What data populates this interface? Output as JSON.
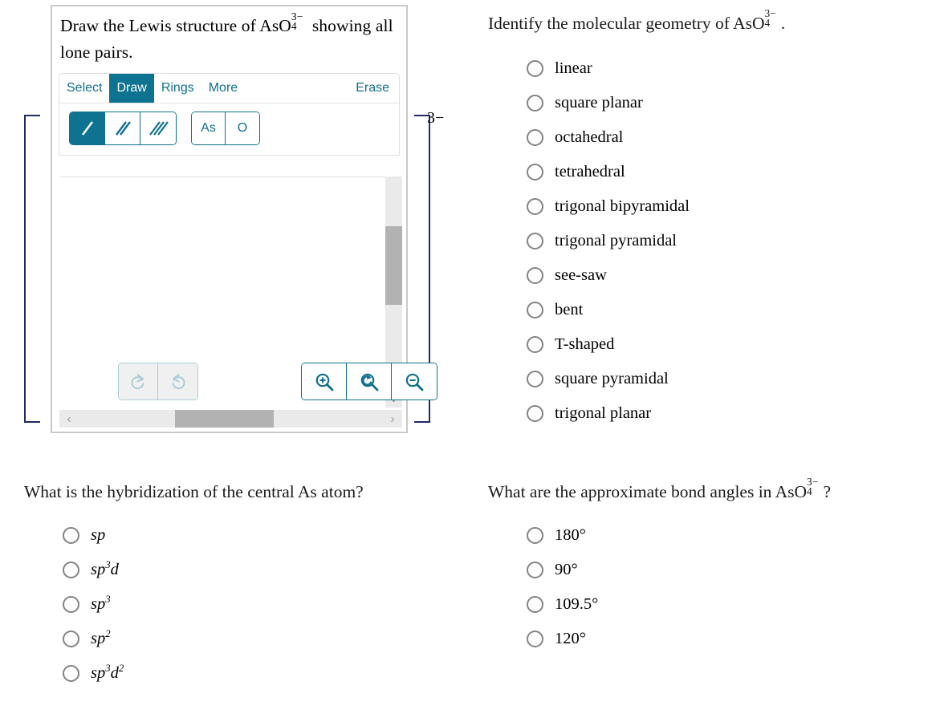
{
  "draw_question": {
    "prompt_prefix": "Draw the Lewis structure of ",
    "formula": {
      "base": "AsO",
      "charge": "3−",
      "index": "4"
    },
    "prompt_suffix": " showing all lone pairs.",
    "charge_bracket_label": "3−"
  },
  "editor": {
    "tabs": [
      {
        "label": "Select",
        "active": false
      },
      {
        "label": "Draw",
        "active": true
      },
      {
        "label": "Rings",
        "active": false
      },
      {
        "label": "More",
        "active": false
      }
    ],
    "erase_label": "Erase",
    "bond_tools": [
      {
        "name": "single-bond",
        "selected": true
      },
      {
        "name": "double-bond",
        "selected": false
      },
      {
        "name": "triple-bond",
        "selected": false
      }
    ],
    "element_buttons": [
      {
        "label": "As"
      },
      {
        "label": "O"
      }
    ],
    "history_buttons": [
      {
        "name": "redo-icon",
        "enabled": false
      },
      {
        "name": "undo-icon",
        "enabled": false
      }
    ],
    "zoom_buttons": [
      {
        "name": "zoom-in-icon"
      },
      {
        "name": "zoom-reset-icon"
      },
      {
        "name": "zoom-out-icon"
      }
    ],
    "scroll": {
      "horizontal_left_chevron": "‹",
      "horizontal_right_chevron": "›",
      "vertical_down_chevron": "∨"
    },
    "colors": {
      "accent": "#0d7390",
      "accent_text": "#10708d",
      "disabled_icon": "#a9cdd8",
      "panel_border": "#c8c8c8",
      "scroll_thumb": "#b2b2b2",
      "bracket": "#1f2a66"
    }
  },
  "geometry_question": {
    "prompt_prefix": "Identify the molecular geometry of ",
    "formula": {
      "base": "AsO",
      "charge": "3−",
      "index": "4"
    },
    "prompt_suffix": ".",
    "options": [
      "linear",
      "square planar",
      "octahedral",
      "tetrahedral",
      "trigonal bipyramidal",
      "trigonal pyramidal",
      "see-saw",
      "bent",
      "T-shaped",
      "square pyramidal",
      "trigonal planar"
    ],
    "selected": null
  },
  "hybridization_question": {
    "prompt": "What is the hybridization of the central As atom?",
    "options": [
      {
        "base": "sp",
        "sup1": "",
        "tail": "",
        "sup2": ""
      },
      {
        "base": "sp",
        "sup1": "3",
        "tail": "d",
        "sup2": ""
      },
      {
        "base": "sp",
        "sup1": "3",
        "tail": "",
        "sup2": ""
      },
      {
        "base": "sp",
        "sup1": "2",
        "tail": "",
        "sup2": ""
      },
      {
        "base": "sp",
        "sup1": "3",
        "tail": "d",
        "sup2": "2"
      }
    ],
    "selected": null
  },
  "angles_question": {
    "prompt_prefix": "What are the approximate bond angles in ",
    "formula": {
      "base": "AsO",
      "charge": "3−",
      "index": "4"
    },
    "prompt_suffix": "?",
    "options": [
      "180°",
      "90°",
      "109.5°",
      "120°"
    ],
    "selected": null
  }
}
